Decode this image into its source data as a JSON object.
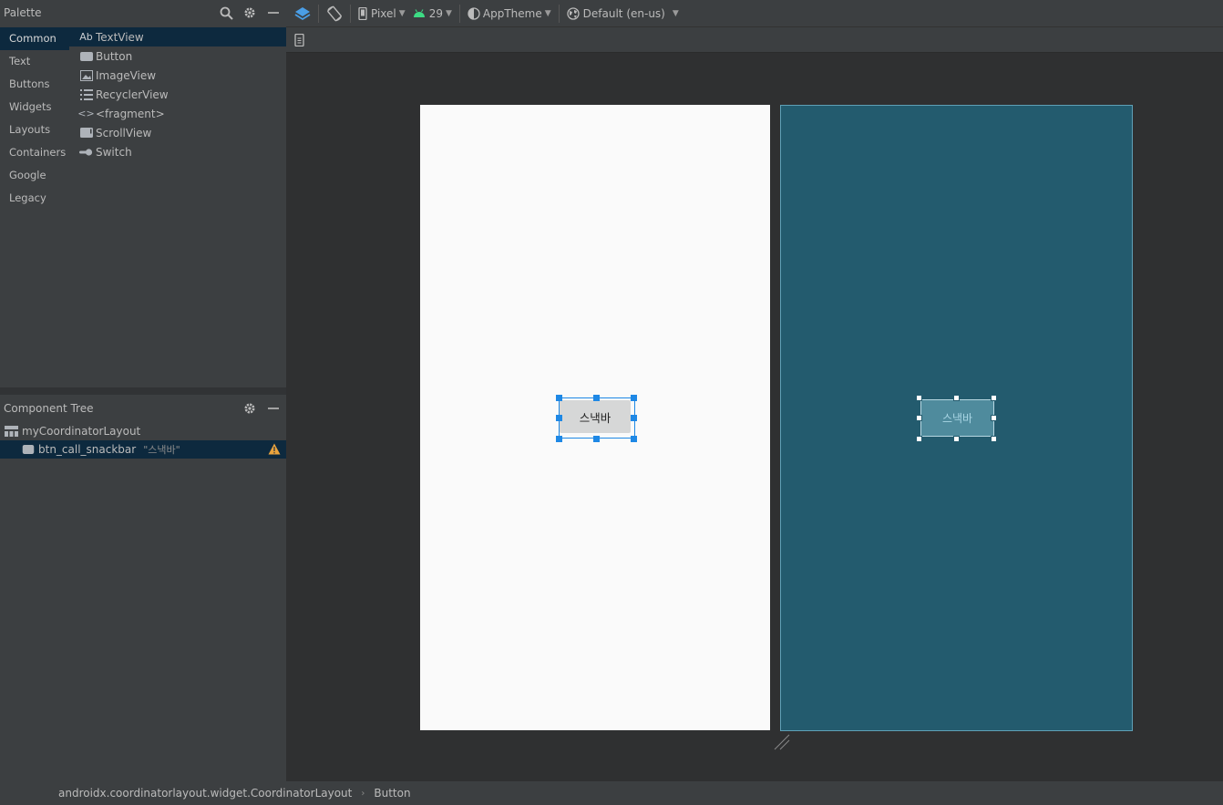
{
  "palette": {
    "title": "Palette",
    "categories": [
      "Common",
      "Text",
      "Buttons",
      "Widgets",
      "Layouts",
      "Containers",
      "Google",
      "Legacy"
    ],
    "selected_category": "Common",
    "widgets": [
      {
        "label": "TextView",
        "icon": "textview-icon",
        "glyph": "Ab"
      },
      {
        "label": "Button",
        "icon": "button-icon",
        "glyph": ""
      },
      {
        "label": "ImageView",
        "icon": "imageview-icon",
        "glyph": ""
      },
      {
        "label": "RecyclerView",
        "icon": "recyclerview-icon",
        "glyph": ""
      },
      {
        "label": "<fragment>",
        "icon": "fragment-icon",
        "glyph": "<>"
      },
      {
        "label": "ScrollView",
        "icon": "scrollview-icon",
        "glyph": ""
      },
      {
        "label": "Switch",
        "icon": "switch-icon",
        "glyph": ""
      }
    ]
  },
  "component_tree": {
    "title": "Component Tree",
    "items": [
      {
        "label": "myCoordinatorLayout",
        "sub": ""
      },
      {
        "label": "btn_call_snackbar",
        "sub": "\"스낵바\""
      }
    ]
  },
  "toolbar": {
    "device": "Pixel",
    "api": "29",
    "theme": "AppTheme",
    "locale": "Default (en-us)"
  },
  "canvas": {
    "button_text": "스낵바"
  },
  "status": {
    "breadcrumbs": [
      "androidx.coordinatorlayout.widget.CoordinatorLayout",
      "Button"
    ]
  },
  "colors": {
    "accent": "#1e88e5",
    "blueprint": "#235b6e",
    "warning": "#e8a33d",
    "android_green": "#3ddc84"
  }
}
